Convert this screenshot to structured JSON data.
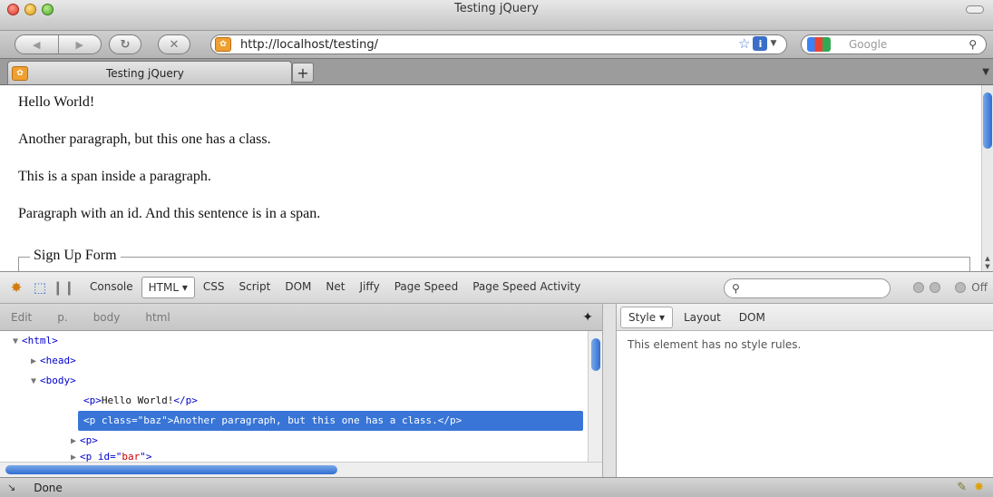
{
  "window": {
    "title": "Testing jQuery"
  },
  "toolbar": {
    "url": "http://localhost/testing/",
    "search_placeholder": "Google"
  },
  "tabs": [
    {
      "label": "Testing jQuery"
    }
  ],
  "page": {
    "paragraphs": [
      "Hello World!",
      "Another paragraph, but this one has a class.",
      "This is a span inside a paragraph.",
      "Paragraph with an id. And this sentence is in a span."
    ],
    "legend": "Sign Up Form"
  },
  "firebug": {
    "tabs": [
      "Console",
      "HTML",
      "CSS",
      "Script",
      "DOM",
      "Net",
      "Jiffy",
      "Page Speed",
      "Page Speed Activity"
    ],
    "active_tab": "HTML",
    "off_label": "Off",
    "breadcrumb": [
      "Edit",
      "p.",
      "body",
      "html"
    ],
    "side_tabs": [
      "Style",
      "Layout",
      "DOM"
    ],
    "style_message": "This element has no style rules.",
    "dom": {
      "html": "<html>",
      "head": "<head>",
      "body": "<body>",
      "p1_open": "<p>",
      "p1_text": "Hello World!",
      "p1_close": "</p>",
      "sel_open": "<p class=\"",
      "sel_cls": "baz",
      "sel_close": "\">",
      "sel_text": "Another paragraph, but this one has a class.",
      "sel_end": "</p>",
      "p3": "<p>",
      "p4_open": "<p id=\"",
      "p4_id": "bar",
      "p4_close": "\">"
    }
  },
  "status": {
    "text": "Done"
  }
}
